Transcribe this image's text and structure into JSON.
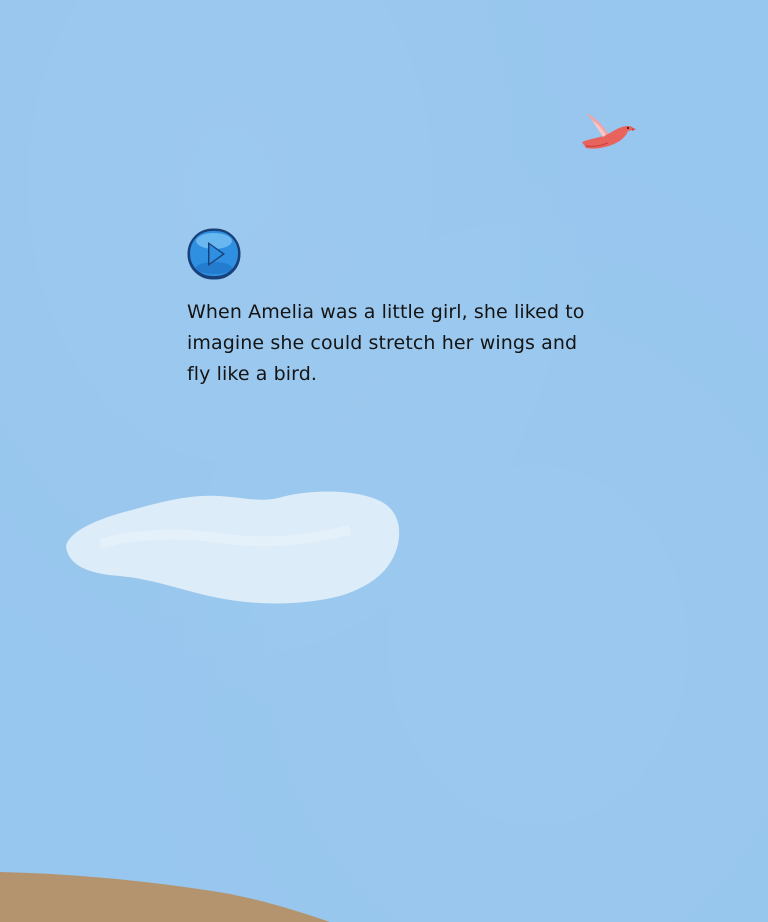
{
  "story": {
    "page_text": "When Amelia was a little girl, she liked to imagine she could stretch her wings and fly like a bird."
  },
  "colors": {
    "sky": "#97c6ee",
    "cloud": "#dcecf8",
    "bird": "#e8635e",
    "play_button": "#2f8fe0",
    "ground": "#b3946e",
    "text": "#141414"
  },
  "icons": {
    "play": "play-icon",
    "bird": "bird-illustration"
  }
}
